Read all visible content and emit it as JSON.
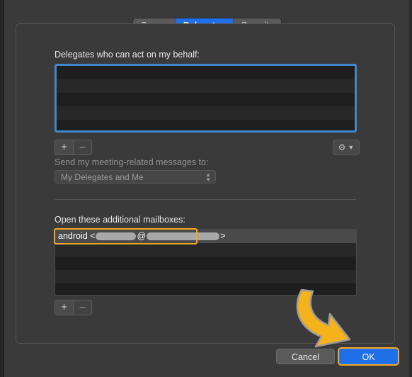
{
  "dialog": {
    "tabs": [
      {
        "label": "Server",
        "active": false
      },
      {
        "label": "Delegates",
        "active": true
      },
      {
        "label": "Security",
        "active": false
      }
    ],
    "delegates_section": {
      "label": "Delegates who can act on my behalf:",
      "rows": [
        "",
        "",
        "",
        "",
        ""
      ],
      "add_button": "+",
      "remove_button": "–",
      "gear_icon": "gear-icon",
      "chevron_icon": "chevron-down-icon"
    },
    "meeting_messages": {
      "label": "Send my meeting-related messages to:",
      "selected": "My Delegates and Me",
      "options": [
        "My Delegates and Me"
      ],
      "disabled": true
    },
    "mailboxes_section": {
      "label": "Open these additional mailboxes:",
      "rows": [
        {
          "prefix": "android <",
          "at": "@",
          "suffix": ">",
          "redacted": true,
          "selected": true
        },
        {
          "prefix": "",
          "at": "",
          "suffix": "",
          "redacted": false,
          "selected": false
        },
        {
          "prefix": "",
          "at": "",
          "suffix": "",
          "redacted": false,
          "selected": false
        },
        {
          "prefix": "",
          "at": "",
          "suffix": "",
          "redacted": false,
          "selected": false
        },
        {
          "prefix": "",
          "at": "",
          "suffix": "",
          "redacted": false,
          "selected": false
        }
      ],
      "add_button": "+",
      "remove_button": "–"
    },
    "footer": {
      "cancel_label": "Cancel",
      "ok_label": "OK"
    },
    "annotation": {
      "arrow_icon": "curved-arrow-icon",
      "arrow_color": "#f5b21b",
      "points_to": "OK"
    },
    "colors": {
      "accent_blue": "#1f6fe8",
      "focus_blue": "#3f87c8",
      "highlight_orange": "#f5a623",
      "window_bg": "#3a3a3a",
      "list_bg": "#1e1e1e"
    }
  }
}
